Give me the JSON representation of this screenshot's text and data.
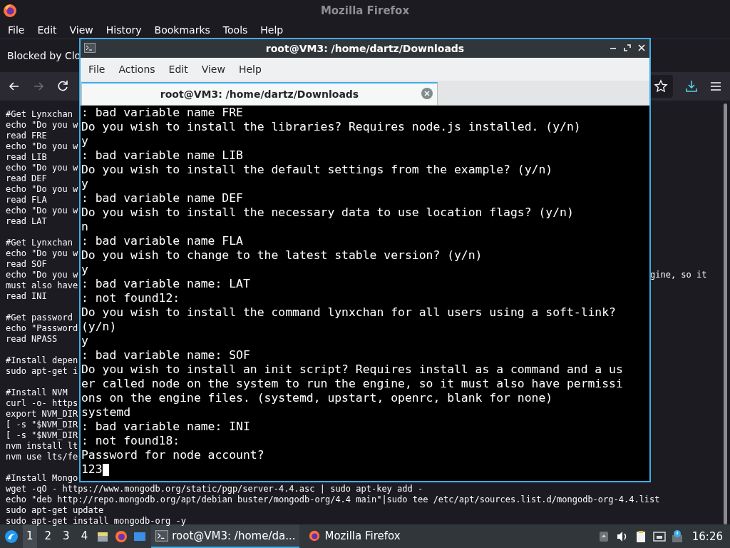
{
  "firefox": {
    "title": "Mozilla Firefox",
    "menu": [
      "File",
      "Edit",
      "View",
      "History",
      "Bookmarks",
      "Tools",
      "Help"
    ],
    "notification": "Blocked by Clo",
    "nav": {
      "forward_disabled": true
    },
    "page_blocks": [
      {
        "lines": [
          {
            "text": "#Get Lynxchan"
          },
          {
            "text": "echo \"Do you w"
          },
          {
            "text": "read FRE"
          },
          {
            "text": "echo \"Do you w"
          },
          {
            "text": "read LIB"
          },
          {
            "text": "echo \"Do you w"
          },
          {
            "text": "read DEF"
          },
          {
            "text": "echo \"Do you w"
          },
          {
            "text": "read FLA"
          },
          {
            "text": "echo \"Do you w"
          },
          {
            "text": "read LAT"
          }
        ]
      },
      {
        "lines": [
          {
            "text": "#Get Lynxchan"
          },
          {
            "text": "echo \"Do you w"
          },
          {
            "text": "read SOF"
          },
          {
            "text": "echo \"Do you w",
            "right": "gine, so it"
          },
          {
            "text": "must also have"
          },
          {
            "text": "read INI"
          }
        ]
      },
      {
        "lines": [
          {
            "text": "#Get password"
          },
          {
            "text": "echo \"Password"
          },
          {
            "text": "read NPASS"
          }
        ]
      },
      {
        "lines": [
          {
            "text": "#Install depen"
          },
          {
            "text": "sudo apt-get i"
          }
        ]
      },
      {
        "lines": [
          {
            "text": "#Install NVM"
          },
          {
            "text": "curl -o- https"
          },
          {
            "text": "export NVM_DIR"
          },
          {
            "text": "[ -s \"$NVM_DIR"
          },
          {
            "text": "[ -s \"$NVM_DIR"
          },
          {
            "text": "nvm install lt"
          },
          {
            "text": "nvm use lts/fe"
          }
        ]
      },
      {
        "lines": [
          {
            "text": "#Install Mongo"
          },
          {
            "text": "wget -qO - https://www.mongodb.org/static/pgp/server-4.4.asc | sudo apt-key add -"
          },
          {
            "text": "echo \"deb http://repo.mongodb.org/apt/debian buster/mongodb-org/4.4 main\"|sudo tee /etc/apt/sources.list.d/mongodb-org-4.4.list"
          },
          {
            "text": "sudo apt-get update"
          },
          {
            "text": "sudo apt-get install mongodb-org -y"
          }
        ]
      }
    ]
  },
  "terminal": {
    "title": "root@VM3: /home/dartz/Downloads",
    "menu": [
      "File",
      "Actions",
      "Edit",
      "View",
      "Help"
    ],
    "tab": {
      "label": "root@VM3: /home/dartz/Downloads",
      "selected": true
    },
    "lines": [
      ": bad variable name FRE",
      "Do you wish to install the libraries? Requires node.js installed. (y/n)",
      "y",
      ": bad variable name LIB",
      "Do you wish to install the default settings from the example? (y/n)",
      "y",
      ": bad variable name DEF",
      "Do you wish to install the necessary data to use location flags? (y/n)",
      "n",
      ": bad variable name FLA",
      "Do you wish to change to the latest stable version? (y/n)",
      "y",
      ": bad variable name: LAT",
      ": not found12:",
      "Do you wish to install the command lynxchan for all users using a soft-link?",
      "(y/n)",
      "y",
      ": bad variable name: SOF",
      "Do you wish to install an init script? Requires install as a command and a us",
      "er called node on the system to run the engine, so it must also have permissi",
      "ons on the engine files. (systemd, upstart, openrc, blank for none)",
      "systemd",
      ": bad variable name: INI",
      ": not found18:",
      "Password for node account?"
    ],
    "input": "123"
  },
  "taskbar": {
    "desktops": [
      {
        "label": "1",
        "selected": true
      },
      {
        "label": "2",
        "selected": false
      },
      {
        "label": "3",
        "selected": false
      },
      {
        "label": "4",
        "selected": false
      }
    ],
    "tasks": [
      {
        "label": "root@VM3: /home/da...",
        "kind": "terminal",
        "selected": true
      },
      {
        "label": "Mozilla Firefox",
        "kind": "firefox",
        "selected": false
      }
    ],
    "clock": "16:26"
  }
}
